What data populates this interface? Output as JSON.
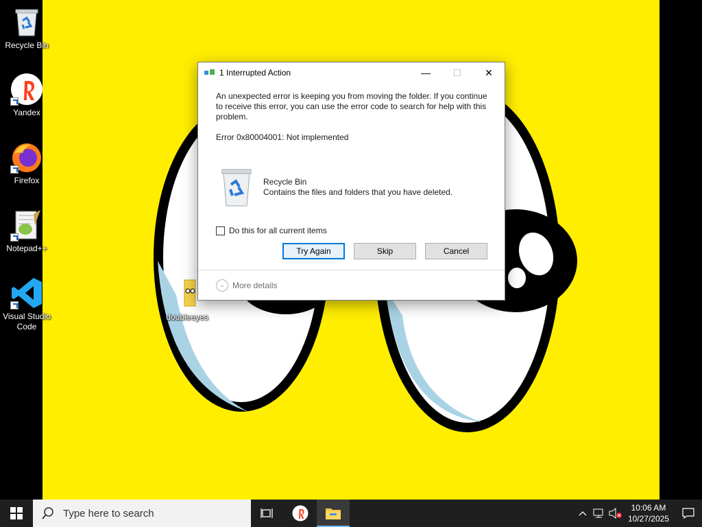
{
  "desktop": {
    "icons": [
      {
        "label": "Recycle Bin"
      },
      {
        "label": "Yandex"
      },
      {
        "label": "Firefox"
      },
      {
        "label": "Notepad++"
      },
      {
        "label": "Visual Studio Code"
      },
      {
        "label": "doubleeyes"
      }
    ]
  },
  "dialog": {
    "title": "1 Interrupted Action",
    "message": "An unexpected error is keeping you from moving the folder. If you continue to receive this error, you can use the error code to search for help with this problem.",
    "error_code": "Error 0x80004001: Not implemented",
    "item_name": "Recycle Bin",
    "item_desc": "Contains the files and folders that you have deleted.",
    "checkbox_label": "Do this for all current items",
    "buttons": {
      "try_again": "Try Again",
      "skip": "Skip",
      "cancel": "Cancel"
    },
    "more_details": "More details",
    "minimize": "—",
    "maximize": "☐",
    "close": "✕"
  },
  "taskbar": {
    "search_placeholder": "Type here to search",
    "time": "10:06 AM",
    "date": "10/27/2025"
  },
  "colors": {
    "wallpaper": "#ffee00",
    "accent": "#0078d7",
    "taskbar": "#1f1f1f"
  }
}
